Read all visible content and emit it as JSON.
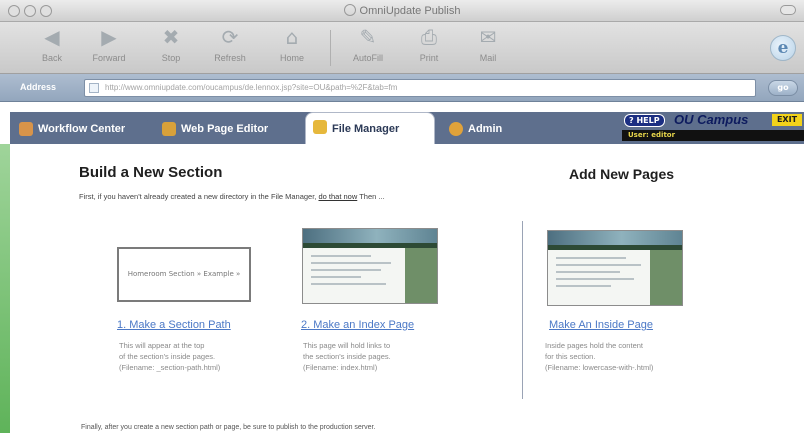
{
  "window": {
    "title": "OmniUpdate Publish"
  },
  "toolbar": {
    "buttons": [
      {
        "label": "Back",
        "icon": "back-arrow-icon"
      },
      {
        "label": "Forward",
        "icon": "forward-arrow-icon"
      },
      {
        "label": "Stop",
        "icon": "stop-icon"
      },
      {
        "label": "Refresh",
        "icon": "refresh-icon"
      },
      {
        "label": "Home",
        "icon": "home-icon"
      },
      {
        "label": "AutoFill",
        "icon": "autofill-icon"
      },
      {
        "label": "Print",
        "icon": "print-icon"
      },
      {
        "label": "Mail",
        "icon": "mail-icon"
      }
    ]
  },
  "addressbar": {
    "label": "Address",
    "url": "http://www.omniupdate.com/oucampus/de.lennox.jsp?site=OU&path=%2F&tab=fm",
    "go_label": "go"
  },
  "tabs": [
    {
      "label": "Workflow Center",
      "active": false,
      "color": "#d8944a"
    },
    {
      "label": "Web Page Editor",
      "active": false,
      "color": "#d8a13a"
    },
    {
      "label": "File Manager",
      "active": true,
      "color": "#e6b83c"
    },
    {
      "label": "Admin",
      "active": false,
      "color": "#e0a23a"
    }
  ],
  "brand": {
    "help_label": "HELP",
    "title": "OU Campus",
    "exit_label": "EXIT",
    "user_text": "User: editor"
  },
  "content": {
    "build_heading": "Build a New Section",
    "intro_text": "First, if you haven't already created a new directory in the File Manager,",
    "intro_link": "do that now",
    "intro_tail": "Then ...",
    "add_heading": "Add New Pages",
    "section_path_thumb_text": "Homeroom Section » Example »",
    "steps": [
      {
        "link": "1. Make a Section Path",
        "desc": [
          "This will appear at the top",
          "of the section's inside pages.",
          "(Filename: _section-path.html)"
        ]
      },
      {
        "link": "2. Make an Index Page",
        "desc": [
          "This page will hold links to",
          "the section's inside pages.",
          "(Filename: index.html)"
        ]
      },
      {
        "link": "Make An Inside Page",
        "desc": [
          "Inside pages hold the content",
          "for this section.",
          "(Filename: lowercase-with-.html)"
        ]
      }
    ],
    "footer_note": "Finally, after you create a new section path or page, be sure to publish to the production server."
  },
  "colors": {
    "tab_band": "#5e6f8d",
    "link": "#4b78c6",
    "exit": "#f2d21a",
    "help_badge": "#1b2e82",
    "desktop_green": "#7ec67a"
  }
}
